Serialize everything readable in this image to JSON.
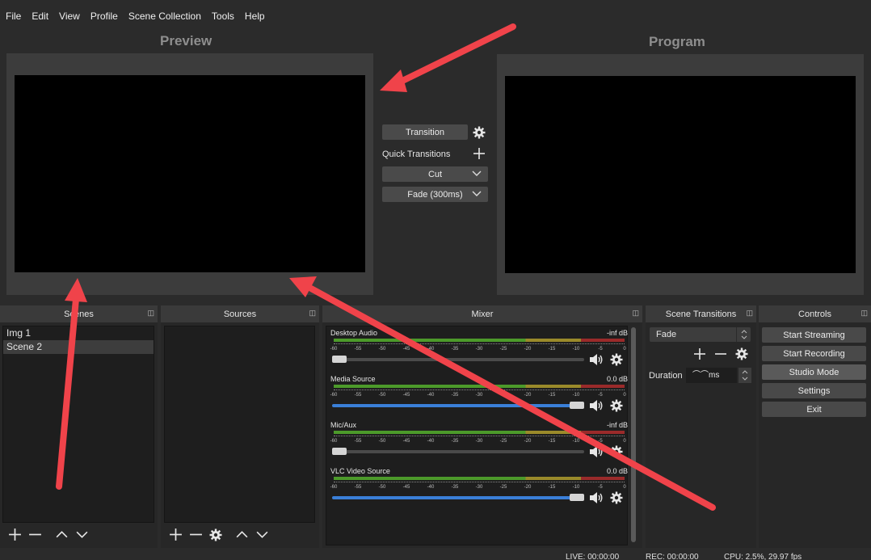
{
  "menu": [
    "File",
    "Edit",
    "View",
    "Profile",
    "Scene Collection",
    "Tools",
    "Help"
  ],
  "preview": {
    "title": "Preview"
  },
  "program": {
    "title": "Program"
  },
  "transitions_center": {
    "transition_label": "Transition",
    "quick_label": "Quick Transitions",
    "cut_label": "Cut",
    "fade_label": "Fade (300ms)"
  },
  "docks": {
    "scenes": {
      "title": "Scenes",
      "items": [
        "Img 1",
        "Scene 2"
      ],
      "selected": "Scene 2"
    },
    "sources": {
      "title": "Sources"
    },
    "mixer": {
      "title": "Mixer",
      "channels": [
        {
          "name": "Desktop Audio",
          "db": "-inf dB",
          "level": 0.0
        },
        {
          "name": "Media Source",
          "db": "0.0 dB",
          "level": 1.0
        },
        {
          "name": "Mic/Aux",
          "db": "-inf dB",
          "level": 0.0
        },
        {
          "name": "VLC Video Source",
          "db": "0.0 dB",
          "level": 1.0
        }
      ],
      "ticks": [
        "-60",
        "-55",
        "-50",
        "-45",
        "-40",
        "-35",
        "-30",
        "-25",
        "-20",
        "-15",
        "-10",
        "-5",
        "0"
      ]
    },
    "scene_transitions": {
      "title": "Scene Transitions",
      "selected": "Fade",
      "duration_label": "Duration",
      "duration_value": "ms"
    },
    "controls": {
      "title": "Controls",
      "buttons": [
        "Start Streaming",
        "Start Recording",
        "Studio Mode",
        "Settings",
        "Exit"
      ]
    }
  },
  "status": {
    "live": "LIVE: 00:00:00",
    "rec": "REC: 00:00:00",
    "cpu": "CPU: 2.5%, 29.97 fps"
  },
  "colors": {
    "annotation_arrow": "#f0434a",
    "meter_green": "#4c9a2a",
    "meter_yellow": "#9a8a2a",
    "meter_red": "#9a2a2a",
    "slider_blue": "#3a7fd8"
  }
}
